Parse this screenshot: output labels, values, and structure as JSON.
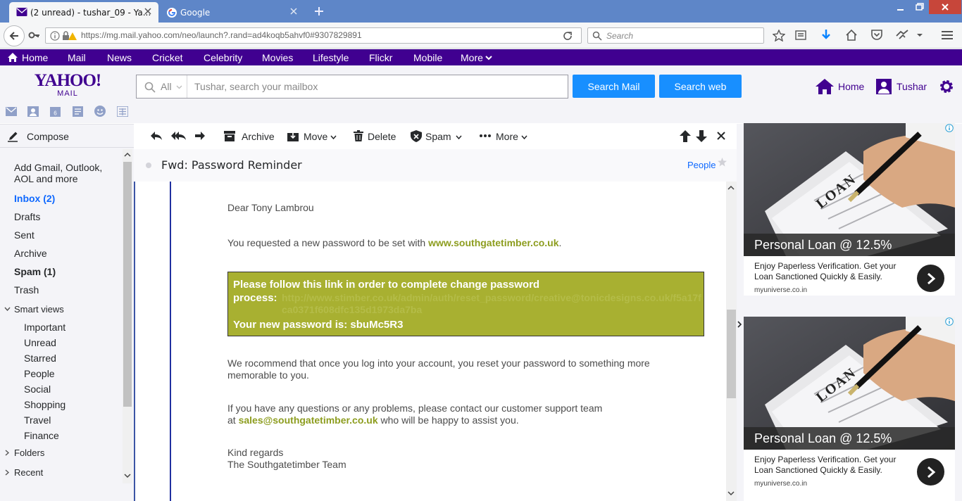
{
  "browser": {
    "tabs": [
      {
        "label": "(2 unread) - tushar_09 - Ya...",
        "active": true
      },
      {
        "label": "Google",
        "active": false
      }
    ],
    "url": "https://mg.mail.yahoo.com/neo/launch?.rand=ad4koqb5ahvf0#9307829891",
    "search_placeholder": "Search"
  },
  "yahoo_nav": {
    "items": [
      "Home",
      "Mail",
      "News",
      "Cricket",
      "Celebrity",
      "Movies",
      "Lifestyle",
      "Flickr",
      "Mobile",
      "More"
    ]
  },
  "header": {
    "logo_top": "YAHOO!",
    "logo_bottom": "MAIL",
    "scope": "All",
    "search_placeholder": "Tushar, search your mailbox",
    "search_mail_label": "Search Mail",
    "search_web_label": "Search web",
    "home_label": "Home",
    "user_label": "Tushar"
  },
  "sidebar": {
    "compose": "Compose",
    "add_accounts": "Add Gmail, Outlook, AOL and more",
    "folders": [
      {
        "label": "Inbox (2)"
      },
      {
        "label": "Drafts"
      },
      {
        "label": "Sent"
      },
      {
        "label": "Archive"
      },
      {
        "label": "Spam (1)"
      },
      {
        "label": "Trash"
      }
    ],
    "smart_views_label": "Smart views",
    "smart_views": [
      "Important",
      "Unread",
      "Starred",
      "People",
      "Social",
      "Shopping",
      "Travel",
      "Finance"
    ],
    "folders_label": "Folders",
    "recent_label": "Recent"
  },
  "toolbar": {
    "archive": "Archive",
    "move": "Move",
    "delete": "Delete",
    "spam": "Spam",
    "more": "More"
  },
  "message": {
    "subject": "Fwd: Password Reminder",
    "people_label": "People",
    "greeting": "Dear Tony Lambrou",
    "requested_prefix": "You requested a new password to be set with ",
    "site_link": "www.southgatetimber.co.uk",
    "requested_suffix": ".",
    "notice_line": "Please follow this link in order to complete change password process:",
    "reset_link": "http://www.stimber.co.uk/admin/auth/reset_password/creative@tonicdesigns.co.uk/f5a17fca0371f608dfc135d1973da7ba",
    "new_password": "Your new password is: sbuMc5R3",
    "recommend": "We rocommend that once you log into your account, you reset your password to something more memorable to you.",
    "questions_line1": "If you have any questions or any problems, please contact our customer support team",
    "questions_at": "at ",
    "support_email": "sales@southgatetimber.co.uk",
    "questions_suffix": " who will be happy to assist you.",
    "regards": "Kind regards",
    "team": "The Southgatetimber Team"
  },
  "ads": [
    {
      "title": "Personal Loan @ 12.5%",
      "description": "Enjoy Paperless Verification. Get your Loan Sanctioned Quickly & Easily.",
      "source": "myuniverse.co.in",
      "image_text": "LOAN"
    },
    {
      "title": "Personal Loan @ 12.5%",
      "description": "Enjoy Paperless Verification. Get your Loan Sanctioned Quickly & Easily.",
      "source": "myuniverse.co.in",
      "image_text": "LOAN"
    }
  ],
  "colors": {
    "yahoo_purple": "#400090",
    "button_blue": "#188fff",
    "link_green": "#8d9d1f",
    "notice_bg": "#a8b031",
    "browser_blue": "#5e86c8"
  }
}
